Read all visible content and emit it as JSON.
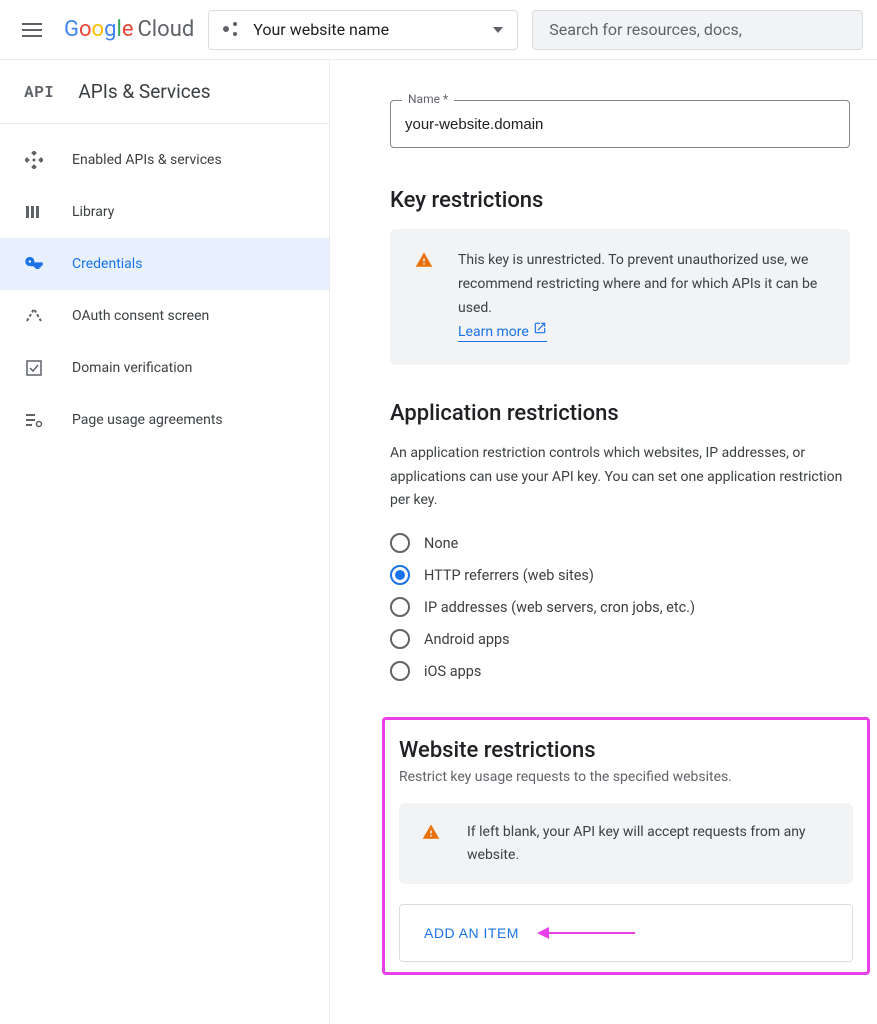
{
  "header": {
    "project_name": "Your website name",
    "search_placeholder": "Search for resources, docs,"
  },
  "logo": {
    "cloud_text": "Cloud"
  },
  "sidebar": {
    "title": "APIs & Services",
    "api_label": "API",
    "items": [
      {
        "label": "Enabled APIs & services"
      },
      {
        "label": "Library"
      },
      {
        "label": "Credentials"
      },
      {
        "label": "OAuth consent screen"
      },
      {
        "label": "Domain verification"
      },
      {
        "label": "Page usage agreements"
      }
    ]
  },
  "main": {
    "name_field": {
      "label": "Name *",
      "value": "your-website.domain"
    },
    "key_restrictions": {
      "title": "Key restrictions",
      "warning": "This key is unrestricted. To prevent unauthorized use, we recommend restricting where and for which APIs it can be used.",
      "learn_more": "Learn more"
    },
    "app_restrictions": {
      "title": "Application restrictions",
      "desc": "An application restriction controls which websites, IP addresses, or applications can use your API key. You can set one application restriction per key.",
      "options": [
        "None",
        "HTTP referrers (web sites)",
        "IP addresses (web servers, cron jobs, etc.)",
        "Android apps",
        "iOS apps"
      ]
    },
    "web_restrictions": {
      "title": "Website restrictions",
      "sub": "Restrict key usage requests to the specified websites.",
      "warn": "If left blank, your API key will accept requests from any website.",
      "add_button": "ADD AN ITEM"
    }
  }
}
